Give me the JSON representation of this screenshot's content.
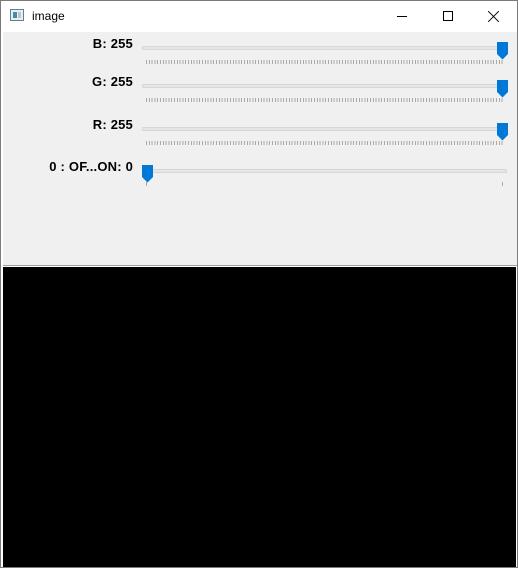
{
  "window": {
    "title": "image",
    "icon": "opencv-window-icon",
    "controls": [
      "minimize-icon",
      "maximize-icon",
      "close-icon"
    ]
  },
  "trackbars": [
    {
      "label": "B: 255",
      "value": 255,
      "max": 255
    },
    {
      "label": "G: 255",
      "value": 255,
      "max": 255
    },
    {
      "label": "R: 255",
      "value": 255,
      "max": 255
    },
    {
      "label": "0 : OF...ON: 0",
      "value": 0,
      "max": 1
    }
  ],
  "colors": {
    "panel_bg": "#f0f0f0",
    "thumb": "#0078d7",
    "image_fill": "#000000"
  }
}
